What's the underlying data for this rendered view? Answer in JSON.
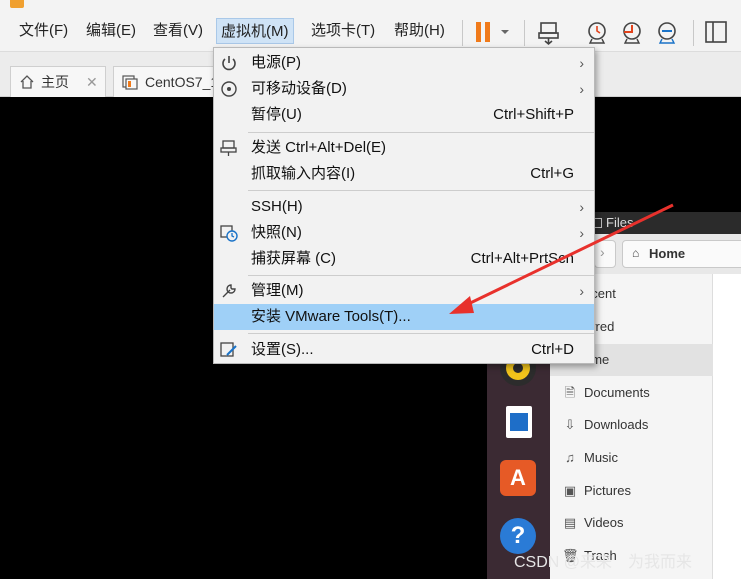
{
  "menubar": {
    "items": [
      "文件(F)",
      "编辑(E)",
      "查看(V)",
      "虚拟机(M)",
      "选项卡(T)",
      "帮助(H)"
    ]
  },
  "tabs": [
    {
      "label": "主页",
      "close": "✕"
    },
    {
      "label": "CentOS7_1"
    }
  ],
  "vm_menu": {
    "items": [
      {
        "label": "电源(P)",
        "shortcut": "",
        "submenu": true,
        "icon": "power-icon"
      },
      {
        "label": "可移动设备(D)",
        "shortcut": "",
        "submenu": true,
        "icon": "disc-icon"
      },
      {
        "label": "暂停(U)",
        "shortcut": "Ctrl+Shift+P",
        "submenu": false,
        "icon": ""
      },
      {
        "label": "发送 Ctrl+Alt+Del(E)",
        "shortcut": "",
        "submenu": false,
        "icon": "send-keys-icon"
      },
      {
        "label": "抓取输入内容(I)",
        "shortcut": "Ctrl+G",
        "submenu": false,
        "icon": ""
      },
      {
        "label": "SSH(H)",
        "shortcut": "",
        "submenu": true,
        "icon": ""
      },
      {
        "label": "快照(N)",
        "shortcut": "",
        "submenu": true,
        "icon": "snapshot-icon"
      },
      {
        "label": "捕获屏幕 (C)",
        "shortcut": "Ctrl+Alt+PrtScn",
        "submenu": false,
        "icon": ""
      },
      {
        "label": "管理(M)",
        "shortcut": "",
        "submenu": true,
        "icon": "wrench-icon"
      },
      {
        "label": "安装 VMware Tools(T)...",
        "shortcut": "",
        "submenu": false,
        "icon": "",
        "highlighted": true
      },
      {
        "label": "设置(S)...",
        "shortcut": "Ctrl+D",
        "submenu": false,
        "icon": "settings-icon"
      }
    ],
    "submenu_arrow": "›"
  },
  "files": {
    "title": "Files",
    "home_label": "Home",
    "sidebar": [
      {
        "label": "ecent",
        "icon": ""
      },
      {
        "label": "arred",
        "icon": ""
      },
      {
        "label": "ome",
        "icon": "",
        "selected": true
      },
      {
        "label": "Documents",
        "icon": "🗎"
      },
      {
        "label": "Downloads",
        "icon": "⇩"
      },
      {
        "label": "Music",
        "icon": "♫"
      },
      {
        "label": "Pictures",
        "icon": "▣"
      },
      {
        "label": "Videos",
        "icon": "▤"
      },
      {
        "label": "Trash",
        "icon": "🗑"
      }
    ]
  },
  "watermark": "CSDN @来来　为我而来",
  "colors": {
    "highlight": "#9fd0f7",
    "menubar_active": "#cfe3f6",
    "pause_orange": "#f07a1a",
    "arrow_red": "#e8312c",
    "dock": "#3b2a33"
  }
}
